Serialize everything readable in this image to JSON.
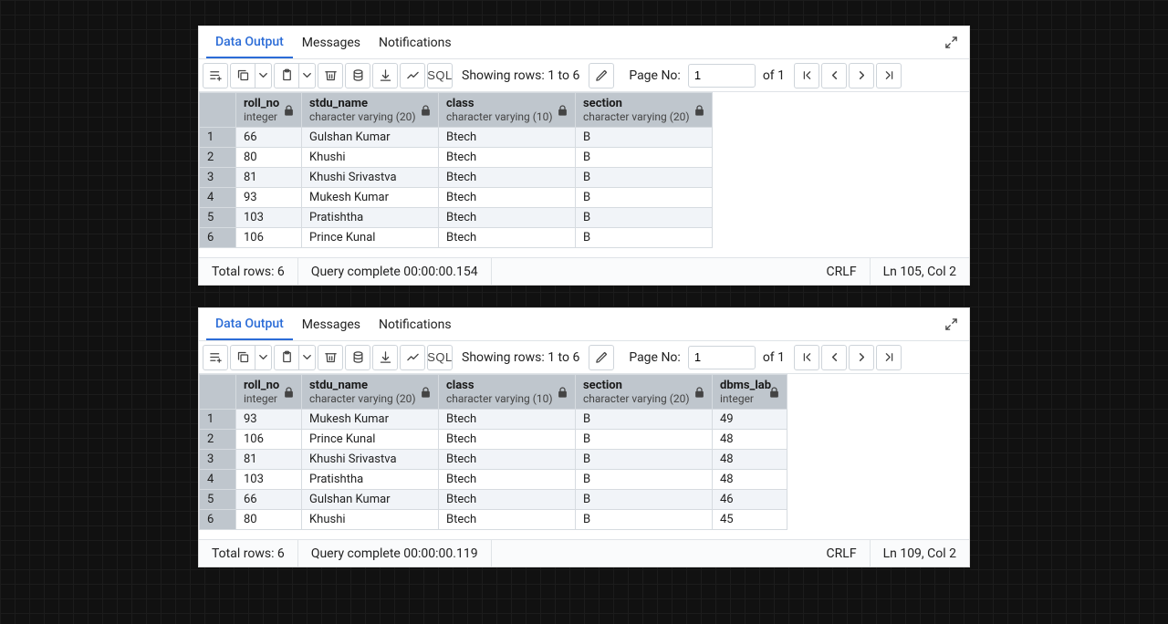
{
  "panel1": {
    "tabs": [
      "Data Output",
      "Messages",
      "Notifications"
    ],
    "rows_text": "Showing rows: 1 to 6",
    "page_label": "Page No:",
    "page_value": "1",
    "of_pages": "of 1",
    "columns": [
      {
        "name": "roll_no",
        "type": "integer",
        "class": "col-roll numcell"
      },
      {
        "name": "stdu_name",
        "type": "character varying (20)",
        "class": "col-name"
      },
      {
        "name": "class",
        "type": "character varying (10)",
        "class": "col-class"
      },
      {
        "name": "section",
        "type": "character varying (20)",
        "class": "col-section"
      }
    ],
    "rows": [
      {
        "n": "1",
        "roll_no": "66",
        "stdu_name": "Gulshan Kumar",
        "class": "Btech",
        "section": "B"
      },
      {
        "n": "2",
        "roll_no": "80",
        "stdu_name": "Khushi",
        "class": "Btech",
        "section": "B"
      },
      {
        "n": "3",
        "roll_no": "81",
        "stdu_name": "Khushi Srivastva",
        "class": "Btech",
        "section": "B"
      },
      {
        "n": "4",
        "roll_no": "93",
        "stdu_name": "Mukesh Kumar",
        "class": "Btech",
        "section": "B"
      },
      {
        "n": "5",
        "roll_no": "103",
        "stdu_name": "Pratishtha",
        "class": "Btech",
        "section": "B"
      },
      {
        "n": "6",
        "roll_no": "106",
        "stdu_name": "Prince Kunal",
        "class": "Btech",
        "section": "B"
      }
    ],
    "total_rows": "Total rows: 6",
    "query_time": "Query complete 00:00:00.154",
    "crlf": "CRLF",
    "cursor": "Ln 105, Col 2"
  },
  "panel2": {
    "tabs": [
      "Data Output",
      "Messages",
      "Notifications"
    ],
    "rows_text": "Showing rows: 1 to 6",
    "page_label": "Page No:",
    "page_value": "1",
    "of_pages": "of 1",
    "columns": [
      {
        "name": "roll_no",
        "type": "integer",
        "class": "col-roll numcell"
      },
      {
        "name": "stdu_name",
        "type": "character varying (20)",
        "class": "col-name"
      },
      {
        "name": "class",
        "type": "character varying (10)",
        "class": "col-class"
      },
      {
        "name": "section",
        "type": "character varying (20)",
        "class": "col-section"
      },
      {
        "name": "dbms_lab",
        "type": "integer",
        "class": "col-dbms numcell"
      }
    ],
    "rows": [
      {
        "n": "1",
        "roll_no": "93",
        "stdu_name": "Mukesh Kumar",
        "class": "Btech",
        "section": "B",
        "dbms_lab": "49"
      },
      {
        "n": "2",
        "roll_no": "106",
        "stdu_name": "Prince Kunal",
        "class": "Btech",
        "section": "B",
        "dbms_lab": "48"
      },
      {
        "n": "3",
        "roll_no": "81",
        "stdu_name": "Khushi Srivastva",
        "class": "Btech",
        "section": "B",
        "dbms_lab": "48"
      },
      {
        "n": "4",
        "roll_no": "103",
        "stdu_name": "Pratishtha",
        "class": "Btech",
        "section": "B",
        "dbms_lab": "48"
      },
      {
        "n": "5",
        "roll_no": "66",
        "stdu_name": "Gulshan Kumar",
        "class": "Btech",
        "section": "B",
        "dbms_lab": "46"
      },
      {
        "n": "6",
        "roll_no": "80",
        "stdu_name": "Khushi",
        "class": "Btech",
        "section": "B",
        "dbms_lab": "45"
      }
    ],
    "total_rows": "Total rows: 6",
    "query_time": "Query complete 00:00:00.119",
    "crlf": "CRLF",
    "cursor": "Ln 109, Col 2"
  },
  "icons": {
    "sql": "SQL"
  }
}
